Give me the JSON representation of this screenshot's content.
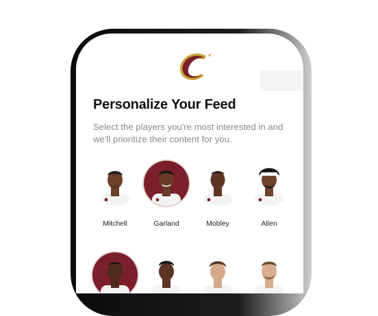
{
  "header": {
    "logo_icon": "cavaliers-c-logo"
  },
  "onboarding": {
    "title": "Personalize Your Feed",
    "subtitle": "Select the players you're most interested in and we'll prioritize their content for you."
  },
  "players": [
    {
      "name": "Mitchell",
      "selected": false,
      "skin": "#6b3f2a"
    },
    {
      "name": "Garland",
      "selected": true,
      "skin": "#6a3a27"
    },
    {
      "name": "Mobley",
      "selected": false,
      "skin": "#5e3524"
    },
    {
      "name": "Allen",
      "selected": false,
      "skin": "#6d4330"
    },
    {
      "name": "",
      "selected": true,
      "skin": "#4d2a1c"
    },
    {
      "name": "",
      "selected": false,
      "skin": "#5c3423"
    },
    {
      "name": "",
      "selected": false,
      "skin": "#d6a98b"
    },
    {
      "name": "",
      "selected": false,
      "skin": "#d9ad90"
    }
  ],
  "colors": {
    "brand_wine": "#7a1f2b",
    "brand_gold": "#c9a23a",
    "title_text": "#111111",
    "subtitle_text": "#8a8a8a"
  }
}
